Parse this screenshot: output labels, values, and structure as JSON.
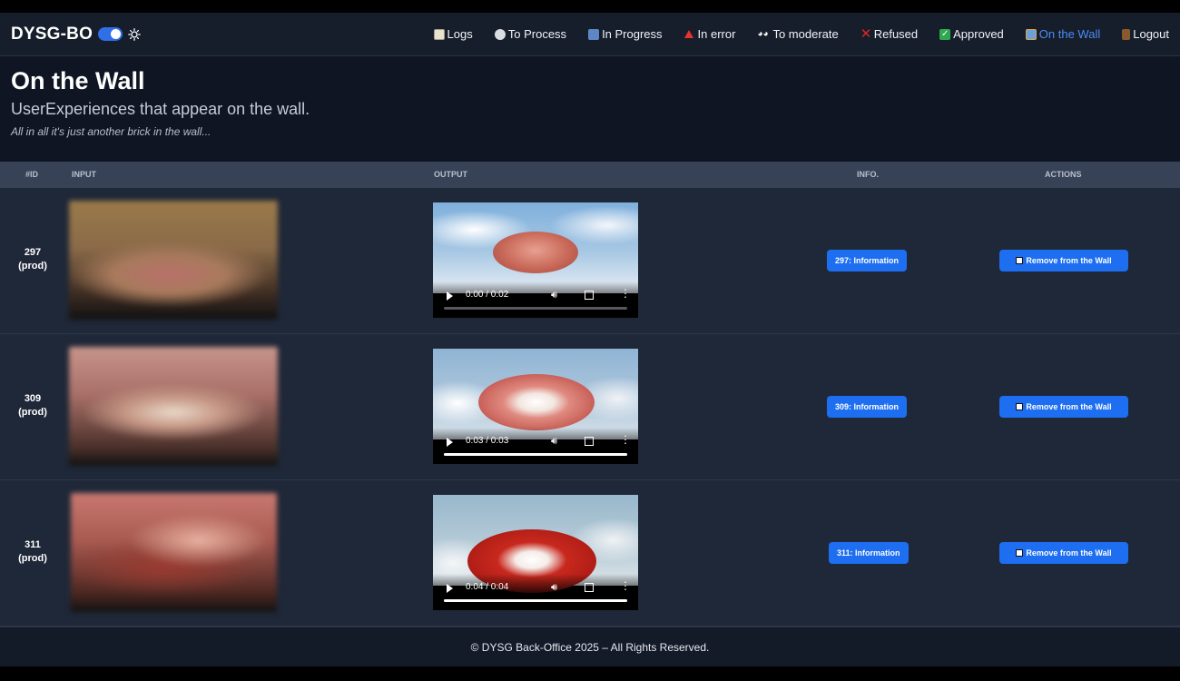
{
  "brand": "DYSG-BO",
  "nav": [
    {
      "label": "Logs",
      "icon": "clipboard-icon",
      "active": false
    },
    {
      "label": "To Process",
      "icon": "clock-icon",
      "active": false
    },
    {
      "label": "In Progress",
      "icon": "play-forward-icon",
      "active": false
    },
    {
      "label": "In error",
      "icon": "warning-triangle-icon",
      "active": false
    },
    {
      "label": "To moderate",
      "icon": "eyes-icon",
      "active": false
    },
    {
      "label": "Refused",
      "icon": "cross-mark-icon",
      "active": false
    },
    {
      "label": "Approved",
      "icon": "check-mark-icon",
      "active": false
    },
    {
      "label": "On the Wall",
      "icon": "framed-picture-icon",
      "active": true
    },
    {
      "label": "Logout",
      "icon": "door-icon",
      "active": false
    }
  ],
  "header": {
    "title": "On the Wall",
    "subtitle": "UserExperiences that appear on the wall.",
    "tagline": "All in all it's just another brick in the wall..."
  },
  "table": {
    "columns": [
      "#ID",
      "INPUT",
      "OUTPUT",
      "INFO.",
      "ACTIONS"
    ],
    "rows": [
      {
        "id": "297",
        "env": "(prod)",
        "time": "0:00 / 0:02",
        "progress": 0.0,
        "info_label": "297: Information",
        "action_label": "Remove from the Wall"
      },
      {
        "id": "309",
        "env": "(prod)",
        "time": "0:03 / 0:03",
        "progress": 1.0,
        "info_label": "309: Information",
        "action_label": "Remove from the Wall"
      },
      {
        "id": "311",
        "env": "(prod)",
        "time": "0:04 / 0:04",
        "progress": 1.0,
        "info_label": "311: Information",
        "action_label": "Remove from the Wall"
      }
    ]
  },
  "footer": "© DYSG Back-Office 2025 – All Rights Reserved.",
  "colors": {
    "accent": "#1d6ef0",
    "active_link": "#4a8ef7",
    "row_bg": "#1f2838",
    "header_row_bg": "#374256"
  }
}
